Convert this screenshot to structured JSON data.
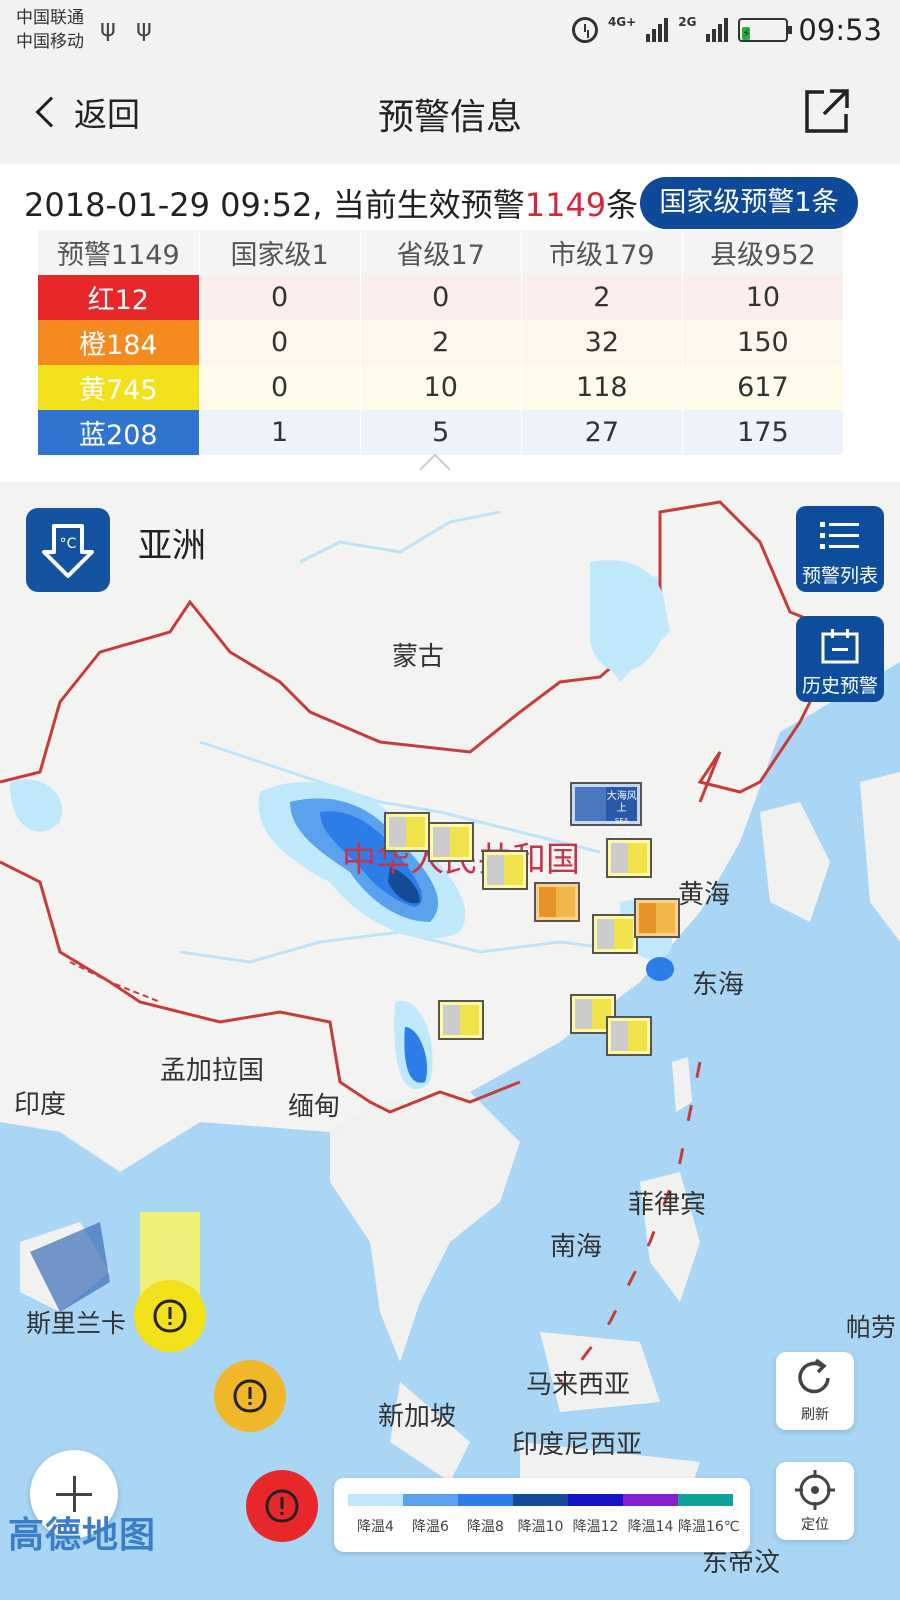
{
  "status_bar": {
    "carrier1": "中国联通",
    "carrier2": "中国移动",
    "net1": "4G+",
    "net2": "2G",
    "time": "09:53"
  },
  "nav": {
    "back_label": "返回",
    "title": "预警信息"
  },
  "summary": {
    "datetime_prefix": "2018-01-29 09:52, 当前生效预警",
    "count": "1149",
    "suffix": "条",
    "national_badge": "国家级预警1条"
  },
  "table": {
    "headers": [
      "预警1149",
      "国家级1",
      "省级17",
      "市级179",
      "县级952"
    ],
    "rows": [
      {
        "label": "红12",
        "color": "#e8272b",
        "values": [
          "0",
          "0",
          "2",
          "10"
        ]
      },
      {
        "label": "橙184",
        "color": "#f58a1f",
        "values": [
          "0",
          "2",
          "32",
          "150"
        ]
      },
      {
        "label": "黄745",
        "color": "#f2e01b",
        "values": [
          "0",
          "10",
          "118",
          "617"
        ]
      },
      {
        "label": "蓝208",
        "color": "#2f74cf",
        "values": [
          "1",
          "5",
          "27",
          "175"
        ]
      }
    ]
  },
  "map": {
    "continent": "亚洲",
    "warning_list_label": "预警列表",
    "history_label": "历史预警",
    "refresh_label": "刷新",
    "locate_label": "定位",
    "logo": "高德地图",
    "labels": {
      "mongolia": "蒙古",
      "prc": "中华人民共和国",
      "yellow_sea": "黄海",
      "east_sea": "东海",
      "bangladesh": "孟加拉国",
      "india": "印度",
      "myanmar": "缅甸",
      "philippines": "菲律宾",
      "south_sea": "南海",
      "sri_lanka": "斯里兰卡",
      "palau": "帕劳",
      "malaysia": "马来西亚",
      "singapore": "新加坡",
      "indonesia": "印度尼西亚",
      "east_timor": "东帝汶",
      "sea_gale": "大海风上",
      "sea_gale_en": "SEA GALE"
    },
    "legend": [
      {
        "label": "降温4",
        "color": "#bfe9fb"
      },
      {
        "label": "降温6",
        "color": "#5aa2ee"
      },
      {
        "label": "降温8",
        "color": "#2d7de8"
      },
      {
        "label": "降温10",
        "color": "#144a96"
      },
      {
        "label": "降温12",
        "color": "#1414c8"
      },
      {
        "label": "降温14",
        "color": "#8a1fd0"
      },
      {
        "label": "降温16℃",
        "color": "#12a09a"
      }
    ]
  }
}
